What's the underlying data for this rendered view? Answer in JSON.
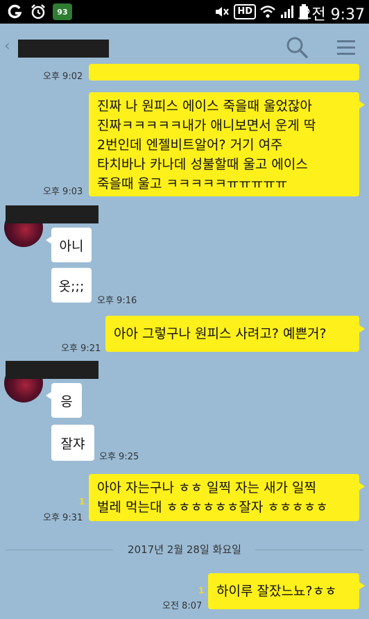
{
  "status_bar": {
    "app_icons": [
      "g-icon",
      "alarm-icon",
      "badge-93"
    ],
    "badge_value": "93",
    "time": "오전 9:37",
    "hd_label": "HD"
  },
  "header": {
    "back_icon": "back-arrow-icon",
    "search_icon": "search-icon",
    "menu_icon": "menu-icon"
  },
  "messages": {
    "m0_time": "오후 9:02",
    "m1_lines": [
      "진짜 나 원피스 에이스 죽을때 울었잖아",
      "진짜ㅋㅋㅋㅋㅋ내가 애니보면서 운게 딱",
      "2번인데 엔젤비트알어? 거기 여주",
      "타치바나 카나데 성불할때 울고 에이스",
      "죽을때 울고 ㅋㅋㅋㅋㅋㅠㅠㅠㅠㅠ"
    ],
    "m1_time": "오후 9:03",
    "m2_text": "아니",
    "m3_text": "옷;;;",
    "m3_time": "오후 9:16",
    "m4_text": "아아 그렇구나 원피스 사려고? 예쁜거?",
    "m4_time": "오후 9:21",
    "m5_text": "응",
    "m6_text": "잘쟈",
    "m6_time": "오후 9:25",
    "m7_lines": [
      "아아 자는구나 ㅎㅎ 일찍 자는 새가 일찍",
      "벌레 먹는대 ㅎㅎㅎㅎㅎㅎ잘자 ㅎㅎㅎㅎㅎ"
    ],
    "m7_read": "1",
    "m7_time": "오후 9:31",
    "date_separator": "2017년 2월 28일 화요일",
    "m8_text": "하이루 잘잤느뇨?ㅎㅎ",
    "m8_read": "1",
    "m8_time": "오전 8:07"
  },
  "colors": {
    "background": "#9bbbd4",
    "my_bubble": "#fef01b",
    "their_bubble": "#ffffff",
    "status_bar": "#000000"
  }
}
